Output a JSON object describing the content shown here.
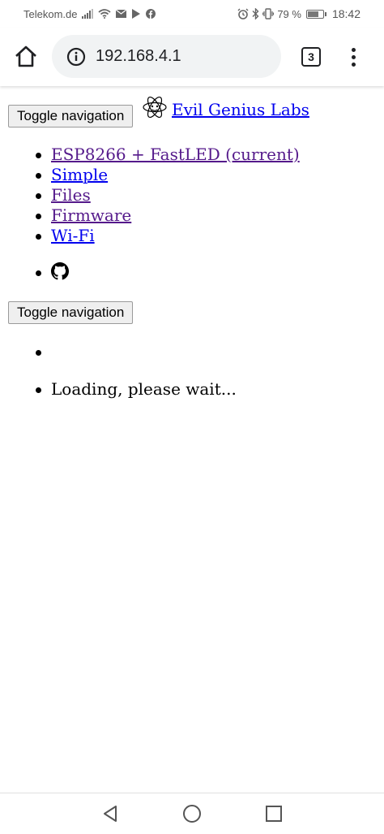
{
  "status_bar": {
    "carrier": "Telekom.de",
    "battery_percent": "79 %",
    "battery_level": 0.79,
    "time": "18:42",
    "icons": [
      "signal-icon",
      "wifi-icon",
      "mail-icon",
      "play-icon",
      "facebook-icon",
      "alarm-icon",
      "bluetooth-icon",
      "vibrate-icon",
      "battery-icon"
    ]
  },
  "browser": {
    "url": "192.168.4.1",
    "tab_count": "3",
    "icons": [
      "home-icon",
      "info-icon",
      "tabs-icon",
      "overflow-menu-icon"
    ]
  },
  "page": {
    "toggle_nav_label": "Toggle navigation",
    "brand": "Evil Genius Labs",
    "nav_items": [
      {
        "label": "ESP8266 + FastLED (current)",
        "visited": true
      },
      {
        "label": "Simple",
        "visited": false
      },
      {
        "label": "Files",
        "visited": true
      },
      {
        "label": "Firmware",
        "visited": true
      },
      {
        "label": "Wi-Fi",
        "visited": false
      }
    ],
    "github_icon": "github-icon",
    "toggle_nav_label_2": "Toggle navigation",
    "status_text": "Loading, please wait..."
  },
  "system_nav": {
    "icons": [
      "back-icon",
      "home-circle-icon",
      "recents-icon"
    ]
  },
  "colors": {
    "link": "#0000ee",
    "visited_link": "#551a8b",
    "omnibox_bg": "#f1f3f4"
  }
}
